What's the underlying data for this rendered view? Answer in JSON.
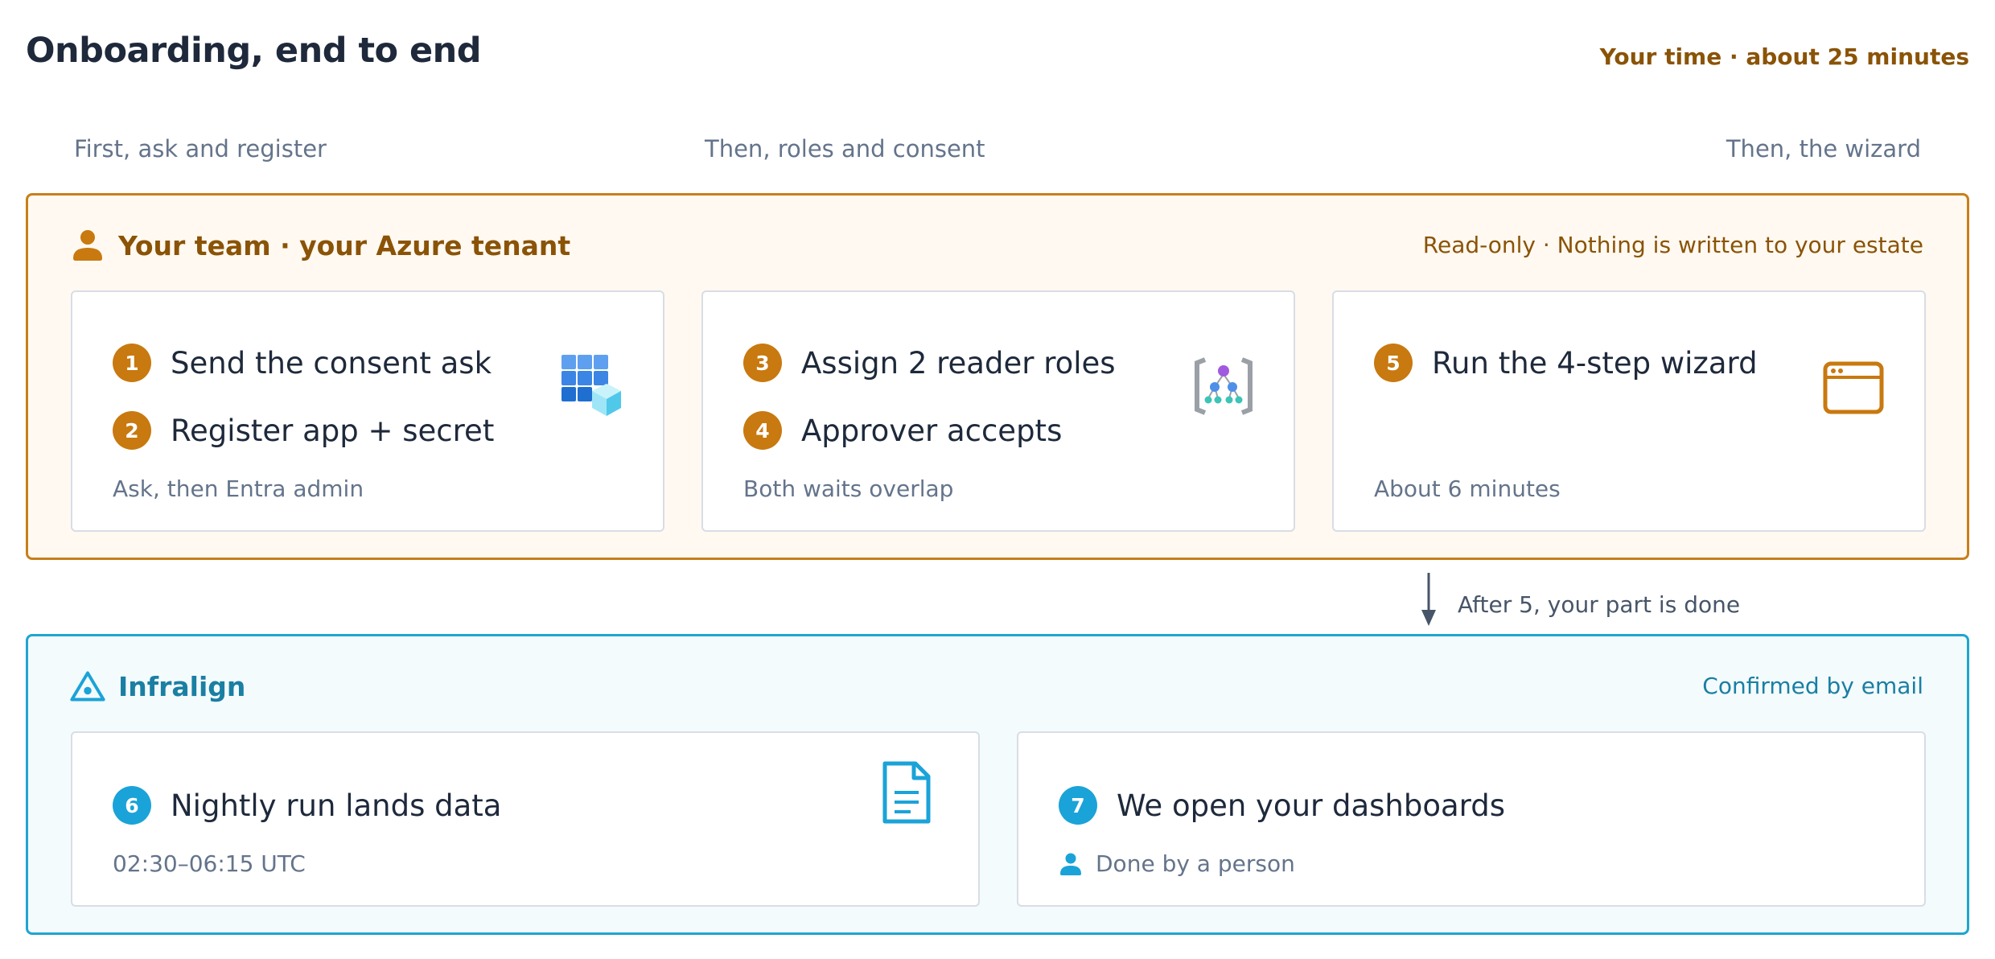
{
  "header": {
    "title": "Onboarding, end to end",
    "time_note": "Your time · about 25 minutes"
  },
  "phases": [
    "First, ask and register",
    "Then, roles and consent",
    "Then, the wizard"
  ],
  "team_group": {
    "icon": "person-icon",
    "title": "Your team · your Azure tenant",
    "note": "Read-only · Nothing is written to your estate",
    "color": "#c87f1a",
    "cards": [
      {
        "icon": "azure-apps-icon",
        "steps": [
          {
            "number": "1",
            "label": "Send the consent ask"
          },
          {
            "number": "2",
            "label": "Register app + secret"
          }
        ],
        "sub": "Ask, then Entra admin"
      },
      {
        "icon": "resource-hierarchy-icon",
        "steps": [
          {
            "number": "3",
            "label": "Assign 2 reader roles"
          },
          {
            "number": "4",
            "label": "Approver accepts"
          }
        ],
        "sub": "Both waits overlap"
      },
      {
        "icon": "browser-window-icon",
        "steps": [
          {
            "number": "5",
            "label": "Run the 4-step wizard"
          }
        ],
        "sub": "About 6 minutes"
      }
    ]
  },
  "connector": {
    "icon": "arrow-down-icon",
    "label": "After 5, your part is done"
  },
  "infra_group": {
    "icon": "infralign-logo-icon",
    "title": "Infralign",
    "note": "Confirmed by email",
    "color": "#1fa5d0",
    "cards": [
      {
        "icon": "document-icon",
        "steps": [
          {
            "number": "6",
            "label": "Nightly run lands data"
          }
        ],
        "sub": "02:30–06:15 UTC"
      },
      {
        "icon": "person-icon",
        "steps": [
          {
            "number": "7",
            "label": "We open your dashboards"
          }
        ],
        "sub": "Done by a person"
      }
    ]
  }
}
